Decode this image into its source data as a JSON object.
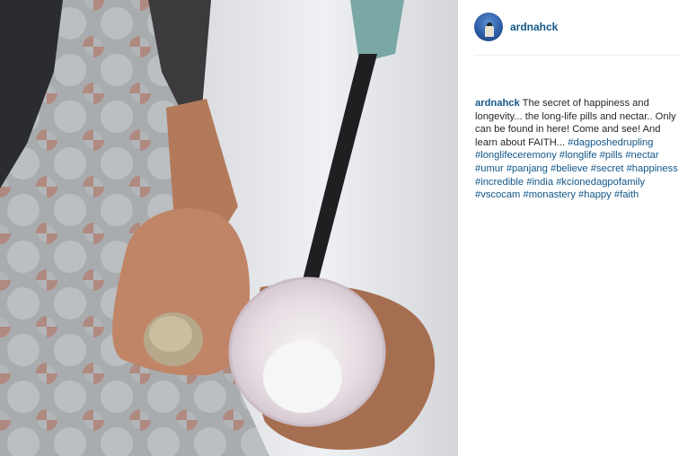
{
  "post": {
    "username": "ardnahck",
    "avatar_icon": "profile-photo-icon",
    "caption_user": "ardnahck",
    "caption_text": "The secret of happiness and longevity... the long-life pills and nectar.. Only can be found in here! Come and see! And learn about FAITH...",
    "hashtags": [
      "#dagposhedrupling",
      "#longlifeceremony",
      "#longlife",
      "#pills",
      "#nectar",
      "#umur",
      "#panjang",
      "#believe",
      "#secret",
      "#happiness",
      "#incredible",
      "#india",
      "#kcionedagpofamily",
      "#vscocam",
      "#monastery",
      "#happy",
      "#faith"
    ]
  },
  "colors": {
    "link": "#125688",
    "text": "#262626",
    "divider": "#efefef"
  }
}
